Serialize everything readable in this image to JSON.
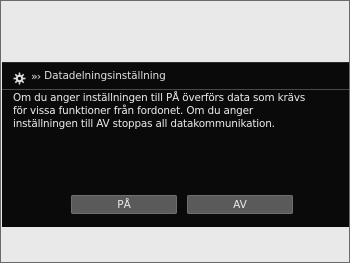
{
  "dialog": {
    "title": "Datadelningsinställning",
    "title_prefix": "»›",
    "icon": "gear-icon",
    "message": "Om du anger inställningen till PÅ överförs data som krävs för vissa funktioner från fordonet. Om du anger inställningen till AV stoppas all datakommunikation.",
    "buttons": {
      "on_label": "PÅ",
      "off_label": "AV"
    }
  },
  "colors": {
    "dialog_background": "#0a0a0a",
    "button_background": "#5a5a5a",
    "frame_background": "#e9e9e9",
    "text": "#e6e6e6"
  }
}
